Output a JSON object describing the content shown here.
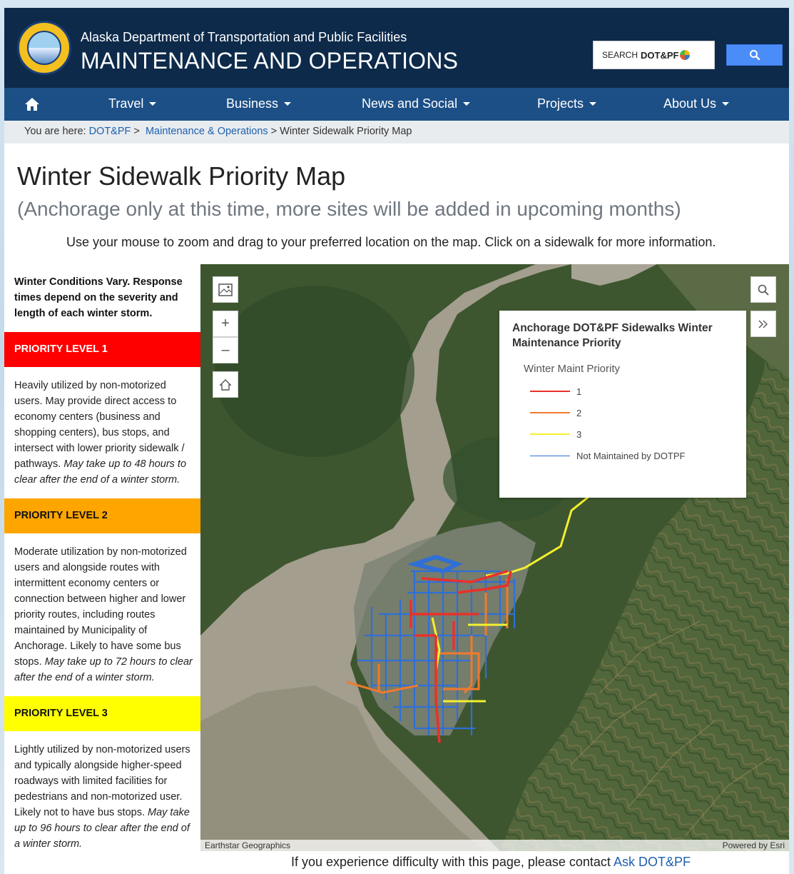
{
  "header": {
    "agency": "Alaska Department of Transportation and Public Facilities",
    "division": "MAINTENANCE AND OPERATIONS",
    "search_prefix": "SEARCH",
    "search_brand": "DOT&PF",
    "search_icon": "search-icon",
    "seal_icon": "state-seal-logo"
  },
  "nav": {
    "home_icon": "home-icon",
    "items": [
      "Travel",
      "Business",
      "News and Social",
      "Projects",
      "About Us"
    ]
  },
  "breadcrumb": {
    "prefix": "You are here:",
    "links": [
      "DOT&PF",
      "Maintenance & Operations"
    ],
    "current": "Winter Sidewalk Priority Map",
    "separator": ">"
  },
  "page": {
    "title": "Winter Sidewalk Priority Map",
    "subtitle": "(Anchorage only at this time, more sites will be added in upcoming months)",
    "instructions": "Use your mouse to zoom and drag to your preferred location on the map. Click on a sidewalk for more information."
  },
  "sidebar": {
    "intro": "Winter Conditions Vary. Response times depend on the severity and length of each winter storm.",
    "levels": [
      {
        "label": "PRIORITY LEVEL 1",
        "color": "#ff0000",
        "description": "Heavily utilized by non-motorized users. May provide direct access to economy centers (business and shopping centers), bus stops, and intersect with lower priority sidewalk / pathways.",
        "timing": "May take up to 48 hours to clear after the end of a winter storm."
      },
      {
        "label": "PRIORITY LEVEL 2",
        "color": "#ffa500",
        "description": "Moderate utilization by non-motorized users and alongside routes with intermittent economy centers or connection between higher and lower priority routes, including routes maintained by Municipality of Anchorage. Likely to have some bus stops.",
        "timing": "May take up to 72 hours to clear after the end of a winter storm."
      },
      {
        "label": "PRIORITY LEVEL 3",
        "color": "#ffff00",
        "description": "Lightly utilized by non-motorized users and typically alongside higher-speed roadways with limited facilities for pedestrians and non-motorized user. Likely not to have bus stops.",
        "timing": "May take up to 96 hours to clear after the end of a winter storm."
      }
    ]
  },
  "map": {
    "legend_title": "Anchorage DOT&PF Sidewalks Winter Maintenance Priority",
    "legend_field": "Winter Maint Priority",
    "legend_items": [
      {
        "label": "1",
        "color": "#e8312a"
      },
      {
        "label": "2",
        "color": "#f07a2c"
      },
      {
        "label": "3",
        "color": "#f4ef2f"
      },
      {
        "label": "Not Maintained by DOTPF",
        "color": "#2f6fd6"
      }
    ],
    "controls": {
      "basemap_icon": "basemap-gallery-icon",
      "zoom_in": "+",
      "zoom_out": "–",
      "home_icon": "home-extent-icon",
      "search_icon": "search-icon",
      "expand_icon": "expand-chevrons-icon"
    },
    "attribution_left": "Earthstar Geographics",
    "attribution_right": "Powered by Esri"
  },
  "footer": {
    "text": "If you experience difficulty with this page, please contact",
    "link": "Ask DOT&PF"
  }
}
